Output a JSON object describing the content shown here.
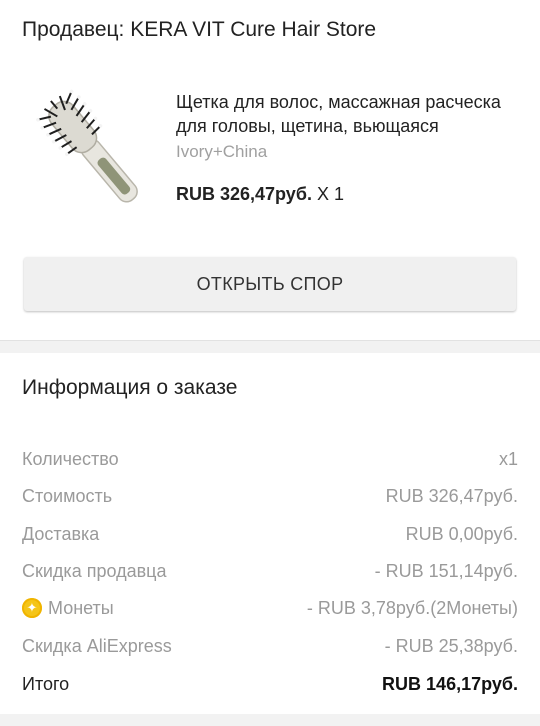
{
  "seller": {
    "label": "Продавец: KERA VIT Cure Hair Store"
  },
  "product": {
    "title": "Щетка для волос, массажная расческа для головы, щетина, вьющаяся",
    "variant": "Ivory+China",
    "price": "RUB 326,47руб.",
    "quantity": "X 1",
    "image_icon": "hairbrush-image"
  },
  "dispute_button": {
    "label": "ОТКРЫТЬ СПОР"
  },
  "order_info": {
    "title": "Информация о заказе",
    "rows": [
      {
        "label": "Количество",
        "value": "x1"
      },
      {
        "label": "Стоимость",
        "value": "RUB 326,47руб."
      },
      {
        "label": "Доставка",
        "value": "RUB 0,00руб."
      },
      {
        "label": "Скидка продавца",
        "value": "- RUB 151,14руб."
      },
      {
        "label": "Монеты",
        "value": "- RUB 3,78руб.(2Монеты)",
        "icon": "coin-icon"
      },
      {
        "label": "Скидка AliExpress",
        "value": "- RUB 25,38руб."
      },
      {
        "label": "Итого",
        "value": "RUB 146,17руб."
      }
    ]
  },
  "colors": {
    "muted_text": "#9a9a9a",
    "primary_text": "#222222",
    "coin": "#f5c518",
    "button_bg": "#f0f0f0"
  }
}
